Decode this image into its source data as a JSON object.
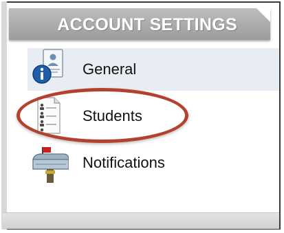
{
  "header": {
    "title": "ACCOUNT SETTINGS"
  },
  "menu": {
    "items": [
      {
        "label": "General",
        "icon": "id-card-info-icon",
        "selected": true
      },
      {
        "label": "Students",
        "icon": "student-roster-icon",
        "selected": false
      },
      {
        "label": "Notifications",
        "icon": "mailbox-icon",
        "selected": false
      }
    ]
  },
  "colors": {
    "header_bg": "#a8a8a8",
    "selected_row": "#e8edf4",
    "highlight_oval": "#b2422e"
  }
}
